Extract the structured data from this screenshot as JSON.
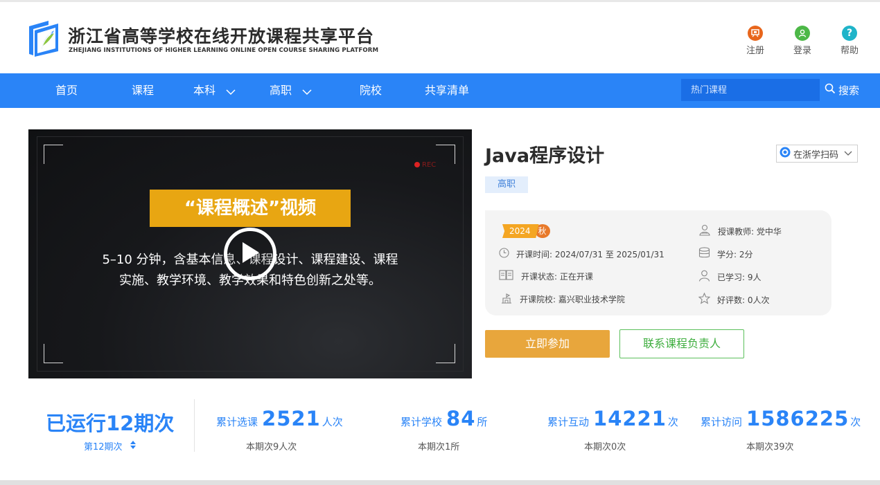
{
  "header": {
    "title_cn": "浙江省高等学校在线开放课程共享平台",
    "title_en": "ZHEJIANG INSTITUTIONS OF HIGHER LEARNING ONLINE OPEN COURSE SHARING PLATFORM",
    "links": [
      {
        "label": "注册",
        "icon": "register-icon",
        "color": "#e8661c"
      },
      {
        "label": "登录",
        "icon": "user-icon",
        "color": "#4cb847"
      },
      {
        "label": "帮助",
        "icon": "help-icon",
        "color": "#1fb4c9"
      }
    ]
  },
  "nav": {
    "items": [
      "首页",
      "课程",
      "本科",
      "高职",
      "院校",
      "共享清单"
    ],
    "search_placeholder": "热门课程",
    "search_label": "搜索",
    "color": "#2a84f7"
  },
  "video": {
    "banner": "“课程概述”视频",
    "desc_line1": "5–10 分钟，含基本信息、课程设计、课程建设、课程",
    "desc_line2": "实施、教学环境、教学效果和特色创新之处等。",
    "rec": "REC"
  },
  "course": {
    "title": "Java程序设计",
    "scan_label": "在浙学扫码",
    "level": "高职",
    "term_year": "2024",
    "term_season": "秋",
    "info": {
      "time": "开课时间:  2024/07/31 至 2025/01/31",
      "status": "开课状态:  正在开课",
      "school": "开课院校:  嘉兴职业技术学院",
      "teacher": "授课教师:  党中华",
      "credit": "学分:  2分",
      "learners": "已学习:  9人",
      "reviews": "好评数:  0人次"
    },
    "join_label": "立即参加",
    "contact_label": "联系课程负责人"
  },
  "stats": {
    "run_title": "已运行12期次",
    "run_sub": "第12期次",
    "items": [
      {
        "label": "累计选课",
        "value": "2521",
        "unit": "人次",
        "sub": "本期次9人次"
      },
      {
        "label": "累计学校",
        "value": "84",
        "unit": "所",
        "sub": "本期次1所"
      },
      {
        "label": "累计互动",
        "value": "14221",
        "unit": "次",
        "sub": "本期次0次"
      },
      {
        "label": "累计访问",
        "value": "1586225",
        "unit": "次",
        "sub": "本期次39次"
      }
    ]
  }
}
